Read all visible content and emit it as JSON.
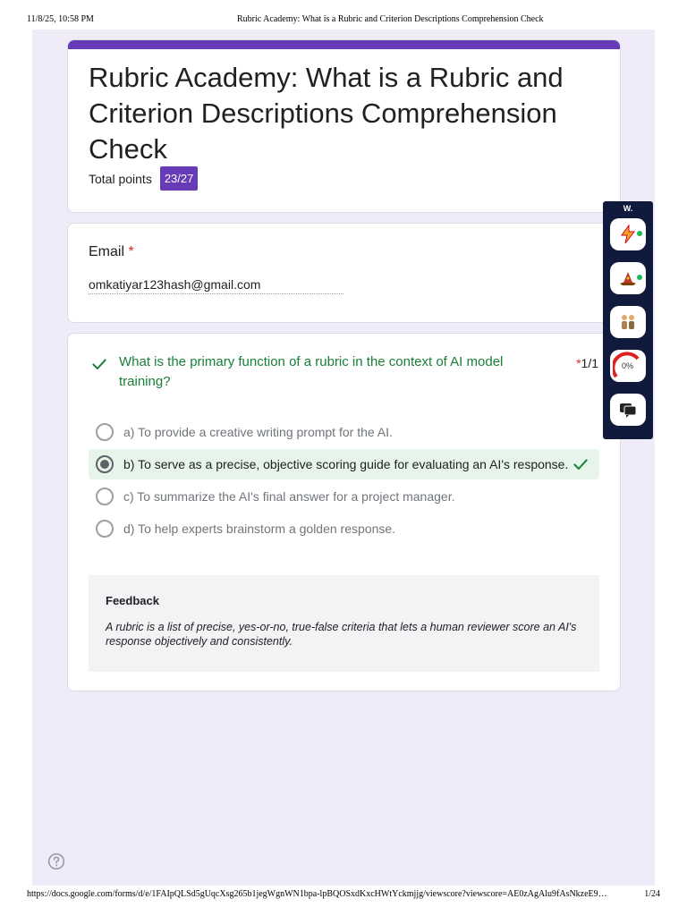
{
  "print_header": {
    "date": "11/8/25, 10:58 PM",
    "title": "Rubric Academy: What is a Rubric and Criterion Descriptions Comprehension Check"
  },
  "print_footer": {
    "url": "https://docs.google.com/forms/d/e/1FAIpQLSd5gUqcXsg265b1jegWgnWN1bpa-lpBQOSxdKxcHWtYckmjjg/viewscore?viewscore=AE0zAgAlu9fAsNkzeE9…",
    "page": "1/24"
  },
  "form": {
    "title": "Rubric Academy: What is a Rubric and Criterion Descriptions Comprehension Check",
    "points_label": "Total points",
    "points_value": "23/27",
    "accent_color": "#673ab7"
  },
  "email": {
    "label": "Email",
    "required_mark": "*",
    "value": "omkatiyar123hash@gmail.com"
  },
  "question": {
    "text": "What is the primary function of a rubric in the context of AI model training?",
    "required_mark": "*",
    "score": "1/1",
    "status_icon": "check-icon",
    "correct_color": "#188038",
    "options": [
      {
        "label": "a) To provide a creative writing prompt for the AI.",
        "selected": false
      },
      {
        "label": "b) To serve as a precise, objective scoring guide for evaluating an AI's response.",
        "selected": true,
        "correct": true
      },
      {
        "label": "c) To summarize the AI's final answer for a project manager.",
        "selected": false
      },
      {
        "label": "d) To help experts brainstorm a golden response.",
        "selected": false
      }
    ],
    "feedback_title": "Feedback",
    "feedback_text": "A rubric is a list of precise, yes-or-no, true-false criteria that lets a human reviewer score an AI's response objectively and consistently."
  },
  "extension_toolbar": {
    "label": "W.",
    "buttons": [
      {
        "icon": "lightning-icon"
      },
      {
        "icon": "wizard-hat-icon"
      },
      {
        "icon": "people-icon"
      },
      {
        "icon": "gauge-icon",
        "text": "0%"
      },
      {
        "icon": "chat-icon"
      }
    ]
  },
  "help": {
    "icon": "help-circle-icon"
  }
}
